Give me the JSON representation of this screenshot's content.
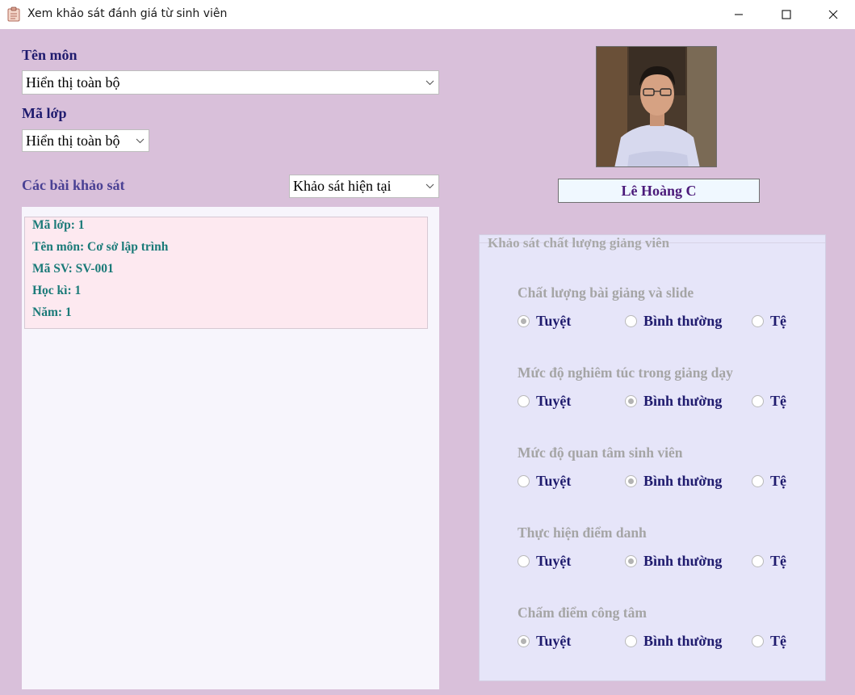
{
  "window": {
    "title": "Xem khảo sát đánh giá từ sinh viên",
    "icon": "clipboard-icon"
  },
  "filters": {
    "subject_label": "Tên môn",
    "subject_value": "Hiển thị toàn bộ",
    "class_label": "Mã lớp",
    "class_value": "Hiển thị toàn bộ"
  },
  "surveys": {
    "section_label": "Các bài khảo sát",
    "filter_value": "Khảo sát hiện tại",
    "items": [
      {
        "class_line": "Mã lớp: 1",
        "subject_line": "Tên môn: Cơ sở lập trình",
        "student_line": "Mã SV: SV-001",
        "semester_line": "Học kì: 1",
        "year_line": "Năm: 1"
      }
    ]
  },
  "lecturer": {
    "name": "Lê Hoàng C",
    "avatar": "person-photo"
  },
  "evaluation": {
    "group_title": "Khảo sát chất lượng giảng viên",
    "options": [
      "Tuyệt",
      "Bình thường",
      "Tệ"
    ],
    "questions": [
      {
        "label": "Chất lượng bài giảng và slide",
        "selected": "Tuyệt"
      },
      {
        "label": "Mức độ nghiêm túc trong giảng dạy",
        "selected": "Bình thường"
      },
      {
        "label": "Mức độ quan tâm sinh viên",
        "selected": "Bình thường"
      },
      {
        "label": "Thực hiện điểm danh",
        "selected": "Bình thường"
      },
      {
        "label": "Chấm điểm công tâm",
        "selected": "Tuyệt"
      }
    ]
  },
  "colors": {
    "background": "#d9c0da",
    "label_text": "#1f1b6e",
    "section_text": "#4a4194",
    "card_background": "#fde9f0",
    "card_text": "#1a7a78",
    "group_background": "#e6e5f9",
    "name_text": "#4b1a7a"
  }
}
